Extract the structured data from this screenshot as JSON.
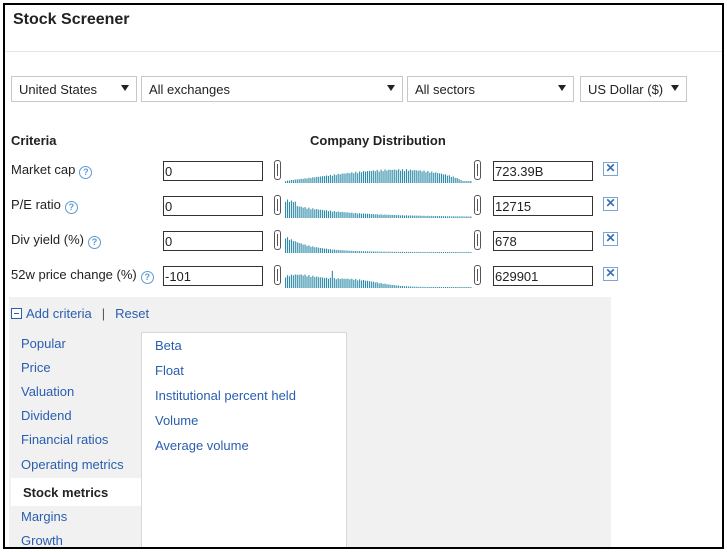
{
  "page": {
    "title": "Stock Screener"
  },
  "filters": {
    "region": "United States",
    "exchange": "All exchanges",
    "sector": "All sectors",
    "currency": "US Dollar ($)"
  },
  "headers": {
    "criteria": "Criteria",
    "distribution": "Company Distribution"
  },
  "help_glyph": "?",
  "remove_glyph": "✕",
  "criteria": [
    {
      "label": "Market cap",
      "min": "0",
      "max": "723.39B"
    },
    {
      "label": "P/E ratio",
      "min": "0",
      "max": "12715"
    },
    {
      "label": "Div yield (%)",
      "min": "0",
      "max": "678"
    },
    {
      "label": "52w price change (%)",
      "min": "-101",
      "max": "629901"
    }
  ],
  "actions": {
    "add_criteria": "Add criteria",
    "separator": "|",
    "reset": "Reset"
  },
  "categories": [
    "Popular",
    "Price",
    "Valuation",
    "Dividend",
    "Financial ratios",
    "Operating metrics",
    "Stock metrics",
    "Margins",
    "Growth"
  ],
  "selected_category": "Stock metrics",
  "subcriteria": [
    "Beta",
    "Float",
    "Institutional percent held",
    "Volume",
    "Average volume"
  ],
  "colors": {
    "link": "#2a5db0",
    "histogram": "#2e8ba8"
  }
}
